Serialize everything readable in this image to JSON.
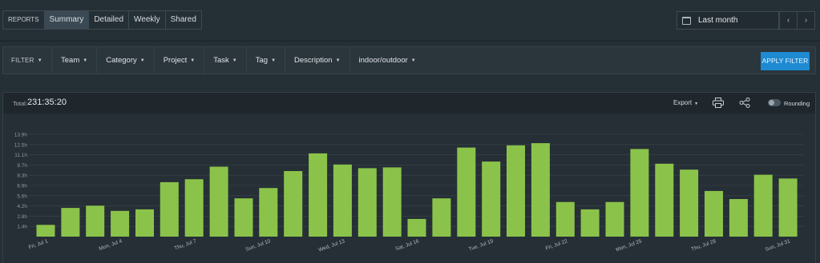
{
  "tabs": [
    {
      "label": "REPORTS"
    },
    {
      "label": "Summary"
    },
    {
      "label": "Detailed"
    },
    {
      "label": "Weekly"
    },
    {
      "label": "Shared"
    }
  ],
  "date_range": {
    "label": "Last month",
    "prev": "‹",
    "next": "›"
  },
  "filters": {
    "filter_label": "FILTER",
    "items": [
      "Team",
      "Category",
      "Project",
      "Task",
      "Tag",
      "Description",
      "indoor/outdoor"
    ],
    "apply_label": "APPLY FILTER"
  },
  "summary": {
    "total_label": "Total:",
    "total_value": "231:35:20",
    "export_label": "Export",
    "rounding_label": "Rounding"
  },
  "colors": {
    "bar": "#8bc34a",
    "accent": "#1d8ad2",
    "grid": "#3a454d"
  },
  "chart_data": {
    "type": "bar",
    "y_ticks": [
      "1.4h",
      "2.8h",
      "4.2h",
      "5.6h",
      "6.9h",
      "8.3h",
      "9.7h",
      "11.1h",
      "12.5h",
      "13.9h"
    ],
    "ylim": [
      0,
      13.9
    ],
    "x_labels": [
      "Fri, Jul 1",
      "Mon, Jul 4",
      "Thu, Jul 7",
      "Sun, Jul 10",
      "Wed, Jul 13",
      "Sat, Jul 16",
      "Tue, Jul 19",
      "Fri, Jul 22",
      "Mon, Jul 25",
      "Thu, Jul 28",
      "Sun, Jul 31"
    ],
    "categories": [
      "Jul 1",
      "Jul 2",
      "Jul 3",
      "Jul 4",
      "Jul 5",
      "Jul 6",
      "Jul 7",
      "Jul 8",
      "Jul 9",
      "Jul 10",
      "Jul 11",
      "Jul 12",
      "Jul 13",
      "Jul 14",
      "Jul 15",
      "Jul 16",
      "Jul 17",
      "Jul 18",
      "Jul 19",
      "Jul 20",
      "Jul 21",
      "Jul 22",
      "Jul 23",
      "Jul 24",
      "Jul 25",
      "Jul 26",
      "Jul 27",
      "Jul 28",
      "Jul 29",
      "Jul 30",
      "Jul 31"
    ],
    "values": [
      1.6,
      3.9,
      4.2,
      3.5,
      3.7,
      7.4,
      7.8,
      9.5,
      5.2,
      6.6,
      8.9,
      11.3,
      9.8,
      9.3,
      9.4,
      2.4,
      5.2,
      12.1,
      10.2,
      12.4,
      12.7,
      4.7,
      3.7,
      4.7,
      11.9,
      9.9,
      9.1,
      6.2,
      5.1,
      8.4,
      7.9
    ],
    "grid": true,
    "legend": "none"
  }
}
